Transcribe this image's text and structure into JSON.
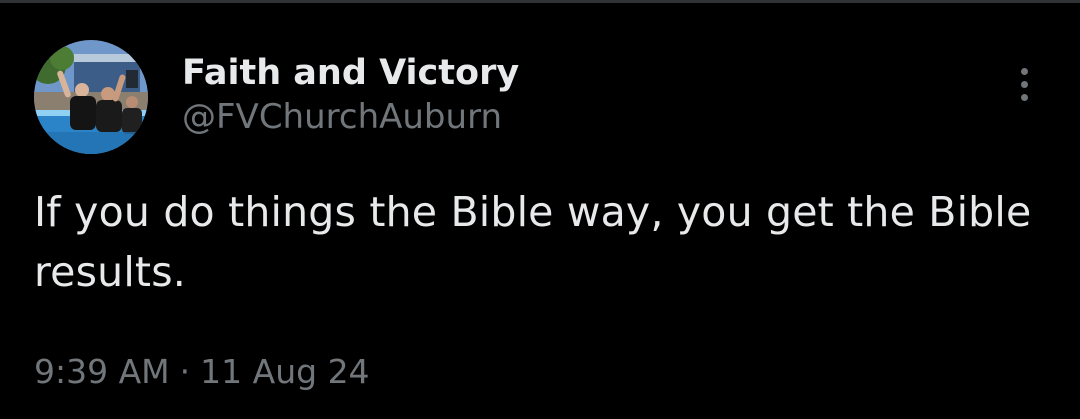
{
  "account": {
    "display_name": "Faith and Victory",
    "handle": "@FVChurchAuburn",
    "avatar": "avatar-photo"
  },
  "tweet": {
    "text": "If you do things the Bible way, you get the Bible results.",
    "time": "9:39 AM",
    "separator": "·",
    "date": "11 Aug 24"
  },
  "icons": {
    "more": "more-options-icon"
  },
  "colors": {
    "background": "#000000",
    "primary_text": "#e7e9ea",
    "secondary_text": "#71767b",
    "divider": "#2f3336"
  }
}
